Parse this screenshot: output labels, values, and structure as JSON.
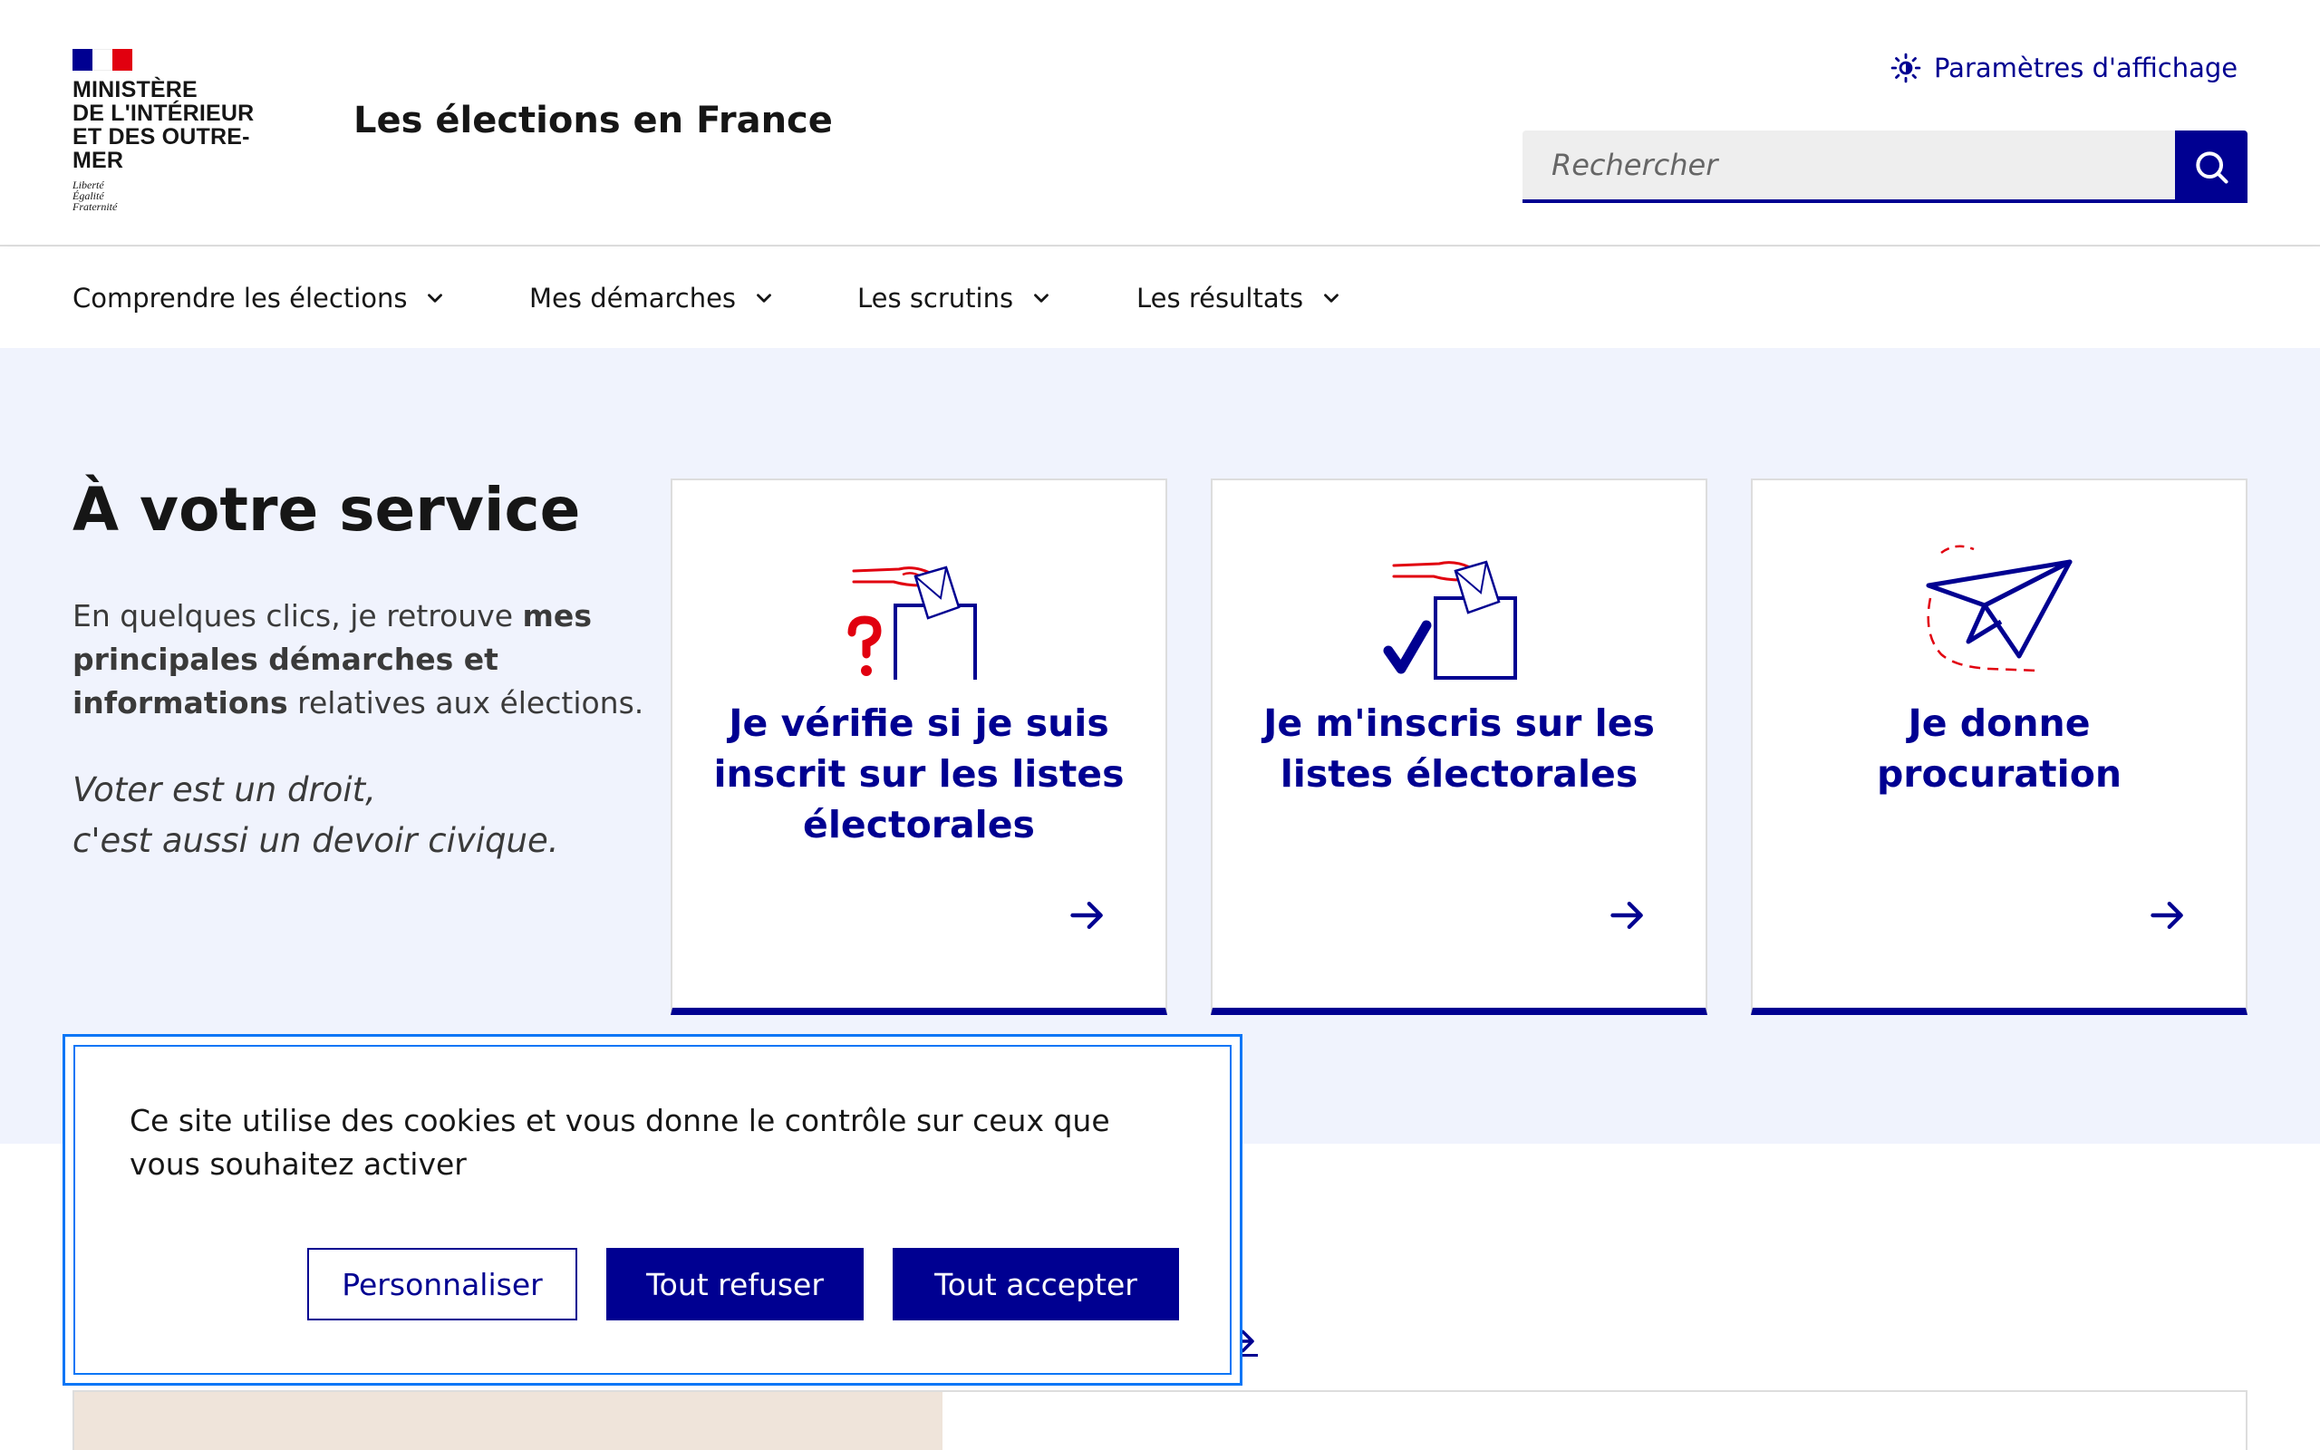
{
  "header": {
    "ministry_lines": [
      "Ministère",
      "de l'Intérieur",
      "et des Outre-mer"
    ],
    "motto": [
      "Liberté",
      "Égalité",
      "Fraternité"
    ],
    "site_title": "Les élections en France",
    "display_settings": "Paramètres d'affichage",
    "search_placeholder": "Rechercher",
    "flag_colors": [
      "#000091",
      "#ffffff",
      "#e1000f"
    ]
  },
  "nav": {
    "items": [
      {
        "label": "Comprendre les élections"
      },
      {
        "label": "Mes démarches"
      },
      {
        "label": "Les scrutins"
      },
      {
        "label": "Les résultats"
      }
    ]
  },
  "services": {
    "title": "À votre service",
    "intro_prefix": "En quelques clics, je retrouve ",
    "intro_bold": "mes principales démarches et informations",
    "intro_suffix": " relatives aux élections.",
    "quote_line1": "Voter est un droit,",
    "quote_line2": "c'est aussi un devoir civique.",
    "cards": [
      {
        "title": "Je vérifie si je suis inscrit sur les listes électorales",
        "icon": "ballot-question-icon"
      },
      {
        "title": "Je m'inscris sur les listes électorales",
        "icon": "ballot-check-icon"
      },
      {
        "title": "Je donne procuration",
        "icon": "paper-plane-icon"
      }
    ]
  },
  "cookie": {
    "text": "Ce site utilise des cookies et vous donne le contrôle sur ceux que vous souhaitez activer",
    "personalize": "Personnaliser",
    "refuse": "Tout refuser",
    "accept": "Tout accepter"
  },
  "colors": {
    "primary": "#000091",
    "accent_red": "#e1000f",
    "hero_background": "#f0f3fd",
    "focus_outline": "#0a76f6"
  }
}
